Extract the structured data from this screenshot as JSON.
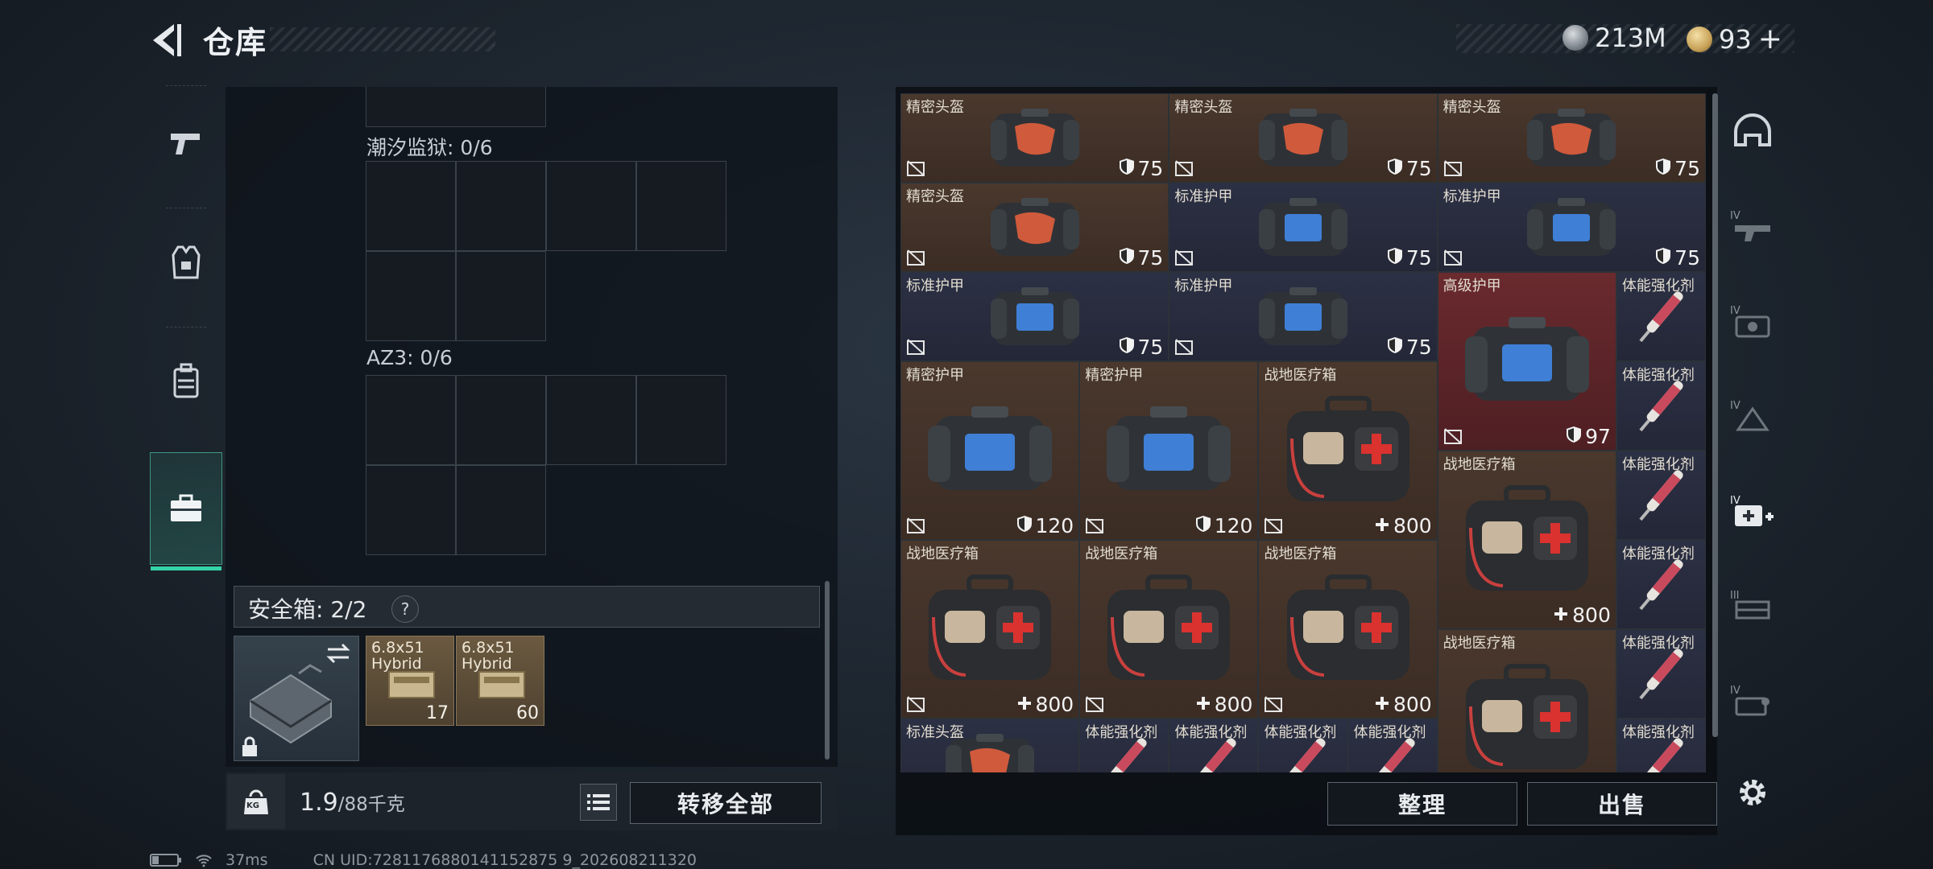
{
  "header": {
    "title": "仓库",
    "currency_1": "213M",
    "currency_2": "93",
    "currency_2_plus": "+"
  },
  "left_panel": {
    "container_1_title": "潮汐监狱: 0/6",
    "container_2_title": "AZ3: 0/6",
    "safebox_label": "安全箱: 2/2",
    "help_label": "?",
    "ammo": [
      {
        "name_line1": "6.8x51",
        "name_line2": "Hybrid",
        "count": "17"
      },
      {
        "name_line1": "6.8x51",
        "name_line2": "Hybrid",
        "count": "60"
      }
    ],
    "weight_current": "1.9",
    "weight_max": "/88千克",
    "weight_lock_label": "KG",
    "transfer_all": "转移全部"
  },
  "stash": {
    "items": [
      {
        "name": "精密头盔",
        "value": "75",
        "value_icon": "shield-icon"
      },
      {
        "name": "精密头盔",
        "value": "75",
        "value_icon": "shield-icon"
      },
      {
        "name": "精密头盔",
        "value": "75",
        "value_icon": "shield-icon"
      },
      {
        "name": "精密头盔",
        "value": "75",
        "value_icon": "shield-icon"
      },
      {
        "name": "标准护甲",
        "value": "75",
        "value_icon": "shield-icon"
      },
      {
        "name": "标准护甲",
        "value": "75",
        "value_icon": "shield-icon"
      },
      {
        "name": "标准护甲",
        "value": "75",
        "value_icon": "shield-icon"
      },
      {
        "name": "标准护甲",
        "value": "75",
        "value_icon": "shield-icon"
      },
      {
        "name": "高级护甲",
        "value": "97",
        "value_icon": "shield-icon"
      },
      {
        "name": "体能强化剂",
        "value": "",
        "value_icon": ""
      },
      {
        "name": "精密护甲",
        "value": "120",
        "value_icon": "shield-icon"
      },
      {
        "name": "精密护甲",
        "value": "120",
        "value_icon": "shield-icon"
      },
      {
        "name": "战地医疗箱",
        "value": "800",
        "value_icon": "plus-icon"
      },
      {
        "name": "体能强化剂",
        "value": "",
        "value_icon": ""
      },
      {
        "name": "战地医疗箱",
        "value": "800",
        "value_icon": "plus-icon"
      },
      {
        "name": "体能强化剂",
        "value": "",
        "value_icon": ""
      },
      {
        "name": "战地医疗箱",
        "value": "800",
        "value_icon": "plus-icon"
      },
      {
        "name": "战地医疗箱",
        "value": "800",
        "value_icon": "plus-icon"
      },
      {
        "name": "战地医疗箱",
        "value": "800",
        "value_icon": "plus-icon"
      },
      {
        "name": "体能强化剂",
        "value": "",
        "value_icon": ""
      },
      {
        "name": "战地医疗箱",
        "value": "",
        "value_icon": ""
      },
      {
        "name": "体能强化剂",
        "value": "",
        "value_icon": ""
      },
      {
        "name": "标准头盔",
        "value": "",
        "value_icon": ""
      },
      {
        "name": "体能强化剂",
        "value": "",
        "value_icon": ""
      },
      {
        "name": "体能强化剂",
        "value": "",
        "value_icon": ""
      },
      {
        "name": "体能强化剂",
        "value": "",
        "value_icon": ""
      },
      {
        "name": "体能强化剂",
        "value": "",
        "value_icon": ""
      },
      {
        "name": "体能强化剂",
        "value": "",
        "value_icon": ""
      }
    ],
    "sort_label": "整理",
    "sell_label": "出售"
  },
  "right_nav": {
    "tab_labels": [
      "IV",
      "IV",
      "IV",
      "IV",
      "III",
      "IV"
    ]
  },
  "status": {
    "ping": "37ms",
    "uid": "CN UID:7281176880141152875 9_202608211320"
  },
  "colors": {
    "accent": "#34d3a8",
    "item_brown": "#4a382d",
    "item_navy": "#2c3044",
    "item_red": "#6a2a2e"
  }
}
